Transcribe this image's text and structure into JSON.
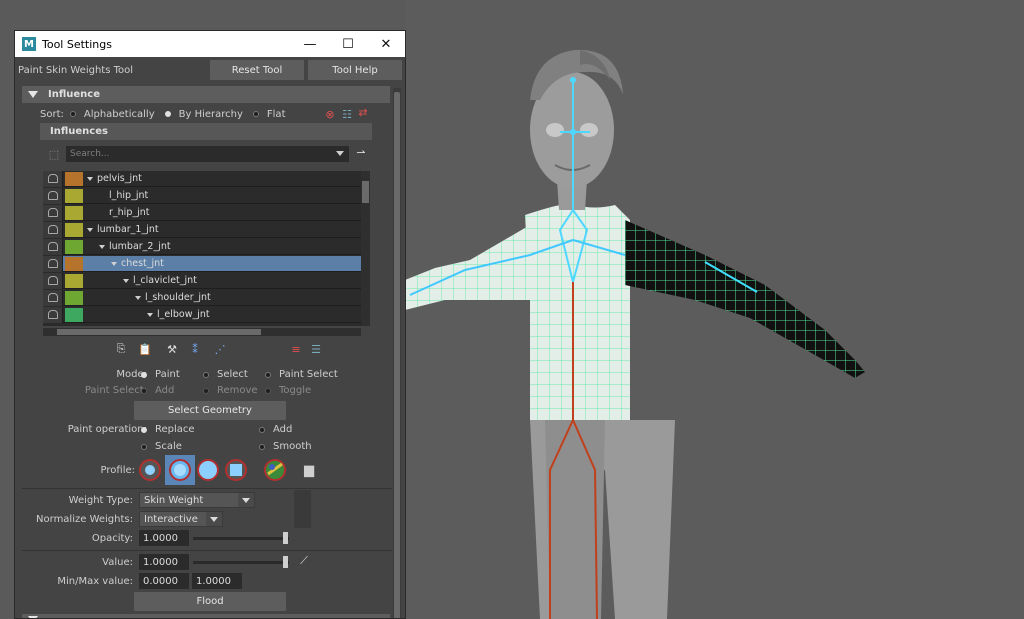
{
  "window": {
    "title": "Tool Settings",
    "logo": "M",
    "minimize": "—",
    "maximize": "☐",
    "close": "✕"
  },
  "tool": {
    "name": "Paint Skin Weights Tool",
    "reset_label": "Reset Tool",
    "help_label": "Tool Help"
  },
  "influence": {
    "section_label": "Influence",
    "sort_label": "Sort:",
    "sort_options": [
      "Alphabetically",
      "By Hierarchy",
      "Flat"
    ],
    "sort_selected": "By Hierarchy",
    "influences_label": "Influences",
    "search_placeholder": "Search...",
    "joints": [
      {
        "name": "pelvis_jnt",
        "color": "#b5732b",
        "depth": 0,
        "expand": true
      },
      {
        "name": "l_hip_jnt",
        "color": "#a8a832",
        "depth": 1,
        "expand": false
      },
      {
        "name": "r_hip_jnt",
        "color": "#a8a832",
        "depth": 1,
        "expand": false
      },
      {
        "name": "lumbar_1_jnt",
        "color": "#a8a832",
        "depth": 0,
        "expand": true
      },
      {
        "name": "lumbar_2_jnt",
        "color": "#6ea832",
        "depth": 1,
        "expand": true
      },
      {
        "name": "chest_jnt",
        "color": "#b5732b",
        "depth": 2,
        "expand": true,
        "selected": true
      },
      {
        "name": "l_claviclet_jnt",
        "color": "#a8a832",
        "depth": 3,
        "expand": true
      },
      {
        "name": "l_shoulder_jnt",
        "color": "#6ea832",
        "depth": 4,
        "expand": true
      },
      {
        "name": "l_elbow_jnt",
        "color": "#3ea860",
        "depth": 5,
        "expand": true
      }
    ]
  },
  "mode": {
    "label": "Mode:",
    "options": [
      "Paint",
      "Select",
      "Paint Select"
    ],
    "selected": "Paint",
    "paint_select_label": "Paint Select:",
    "paint_select_options": [
      "Add",
      "Remove",
      "Toggle"
    ],
    "select_geometry_label": "Select Geometry"
  },
  "paint_operation": {
    "label": "Paint operation:",
    "options": [
      "Replace",
      "Add",
      "Scale",
      "Smooth"
    ],
    "selected": "Replace"
  },
  "profile": {
    "label": "Profile:"
  },
  "weights": {
    "weight_type_label": "Weight Type:",
    "weight_type_value": "Skin Weight",
    "normalize_label": "Normalize Weights:",
    "normalize_value": "Interactive",
    "opacity_label": "Opacity:",
    "opacity_value": "1.0000",
    "value_label": "Value:",
    "value_value": "1.0000",
    "minmax_label": "Min/Max value:",
    "min_value": "0.0000",
    "max_value": "1.0000",
    "flood_label": "Flood"
  },
  "colors": {
    "panel": "#444444",
    "selected_row": "#5b7fa6",
    "viewport": "#5c5c5c",
    "wire": "#7ff5c0",
    "joint": "#4fd8ff",
    "leg_joint": "#c0401c"
  }
}
